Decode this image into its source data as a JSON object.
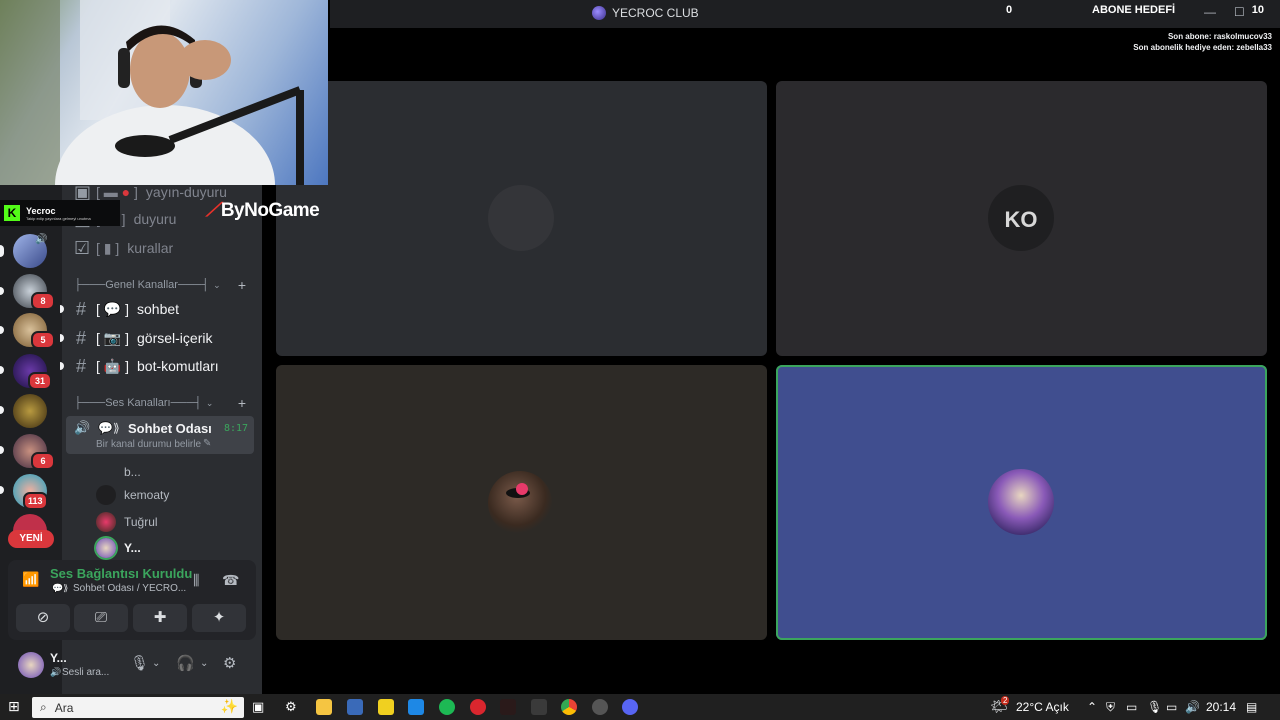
{
  "titlebar": {
    "server_name": "YECROC CLUB"
  },
  "overlay": {
    "sub_goal_count": "0",
    "sub_goal_label": "ABONE HEDEFİ",
    "sub_goal_target": "10",
    "last_sub": "Son abone: raskolmucov33",
    "last_gift": "Son abonelik hediye eden: zebella33"
  },
  "kick": {
    "name": "Yecroc",
    "tagline": "Takip edip yayınlara gelmeyi unutma"
  },
  "sponsor": {
    "name": "ByNoGame"
  },
  "guilds": {
    "badges": [
      "8",
      "5",
      "31",
      "6",
      "113"
    ],
    "new_label": "YENİ"
  },
  "channels": {
    "top": [
      {
        "label": "yayın-duyuru"
      },
      {
        "label": "duyuru"
      },
      {
        "label": "kurallar"
      }
    ],
    "genel_category": "Genel Kanallar",
    "genel": [
      {
        "label": "sohbet"
      },
      {
        "label": "görsel-içerik"
      },
      {
        "label": "bot-komutları"
      }
    ],
    "ses_category": "Ses Kanalları",
    "voice_channel": {
      "name": "Sohbet Odası",
      "time": "8:17",
      "status": "Bir kanal durumu belirle",
      "users": [
        "b...",
        "kemoaty",
        "Tuğrul",
        "Y..."
      ]
    }
  },
  "voice_panel": {
    "status": "Ses Bağlantısı Kuruldu",
    "channel": "Sohbet Odası / YECRO..."
  },
  "user_panel": {
    "name": "Y...",
    "status": "Sesli ara..."
  },
  "taskbar": {
    "search_placeholder": "Ara",
    "weather": "22°C  Açık",
    "weather_badge": "2",
    "clock": "20:14"
  },
  "colors": {
    "speaking": "#3ba55d",
    "tile_blue": "#404e8f",
    "tile_dark": "#2b2d31",
    "tile_brown": "#2d2a26",
    "badge": "#da373c"
  }
}
